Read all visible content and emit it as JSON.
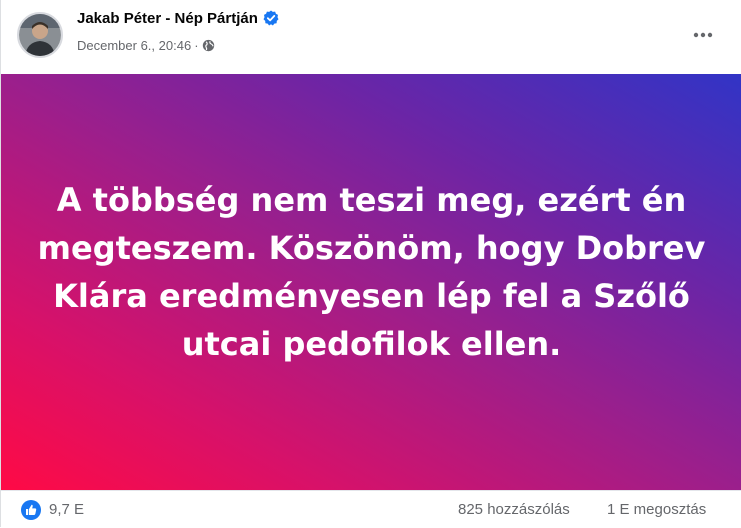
{
  "post": {
    "author": "Jakab Péter - Nép Pártján",
    "verified_icon": "verified-badge-icon",
    "timestamp": "December 6., 20:46",
    "separator": "·",
    "audience_icon": "globe-icon",
    "more_icon": "more-options-icon",
    "banner": {
      "text": "A többség nem teszi meg, ezért én megteszem. Köszönöm, hogy Dobrev Klára eredményesen lép fel a Szőlő utcai pedofilok ellen.",
      "gradient_colors": [
        "#ff0a45",
        "#9b1f8c",
        "#3134c6"
      ]
    },
    "footer": {
      "reaction_icon": "like-icon",
      "reactions": "9,7 E",
      "comments": "825 hozzászólás",
      "shares": "1 E megosztás"
    }
  },
  "colors": {
    "accent": "#1877f2",
    "secondary_text": "#65676b",
    "primary_text": "#050505"
  }
}
